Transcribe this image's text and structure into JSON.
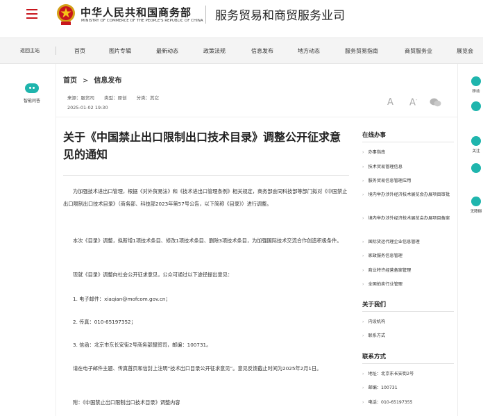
{
  "header": {
    "ministry_cn": "中华人民共和国商务部",
    "ministry_en": "MINISTRY OF COMMERCE OF THE PEOPLE'S REPUBLIC OF CHINA",
    "dept_title": "服务贸易和商贸服务业司"
  },
  "nav": {
    "items": [
      "返回主站",
      "首页",
      "图片专辑",
      "最新动态",
      "政策法规",
      "信息发布",
      "地方动态",
      "服务贸易指南",
      "商贸服务业",
      "展览会"
    ]
  },
  "left_rail": {
    "assistant_label": "智能问答"
  },
  "breadcrumb": {
    "home": "首页",
    "sep": ">",
    "current": "信息发布"
  },
  "meta": {
    "source": "来源：服贸司",
    "type": "类型：原创",
    "category": "分类：其它",
    "date": "2025-01-02 19:30",
    "font_large": "A",
    "font_small": "A",
    "font_small_sup": "-"
  },
  "article": {
    "title": "关于《中国禁止出口限制出口技术目录》调整公开征求意见的通知",
    "paragraphs": [
      "为加强技术进出口管理，根据《对外贸易法》和《技术进出口管理条例》相关规定，商务部会同科技部等部门拟对《中国禁止出口限制出口技术目录》（商务部、科技部2023年第57号公告，以下简称《目录》）进行调整。",
      "本次《目录》调整，拟新增1项技术条目、修改1项技术条目、删除3项技术条目，为加强国际技术交流合作创造积极条件。",
      "现就《目录》调整向社会公开征求意见，公众可通过以下途径提出意见：",
      "1. 电子邮件：xiaqian@mofcom.gov.cn；",
      "2. 传真：010-65197352；",
      "3. 信函：北京市东长安街2号商务部服贸司，邮编：100731。",
      "请在电子邮件主题、传真首页和信封上注明“技术出口目录公开征求意见”。意见反馈截止时间为2025年2月1日。",
      "附：《中国禁止出口限制出口技术目录》调整内容"
    ]
  },
  "sidebar": {
    "online_title": "在线办事",
    "online_links": [
      "办事指南",
      "技术贸易管理信息",
      "服务贸易信息管理应用",
      "境内举办涉外经济技术展览会办展项目审批",
      "境内举办涉外经济技术展览会办展项目备案",
      "国际货运代理企业信息管理",
      "家政服务信息管理",
      "商业特许经营备案管理",
      "全国拍卖行业管理"
    ],
    "about_title": "关于我们",
    "about_links": [
      "内设机构",
      "联系方式"
    ],
    "contact_title": "联系方式",
    "contact_lines": [
      "地址：北京东长安街2号",
      "邮编：100731",
      "电话：010-65197355"
    ]
  },
  "right_rail": {
    "labels": [
      "移动",
      "",
      "关注",
      "",
      "无障碍"
    ]
  },
  "colors": {
    "brand_red": "#c8161d",
    "accent_teal": "#1fb5ad"
  }
}
